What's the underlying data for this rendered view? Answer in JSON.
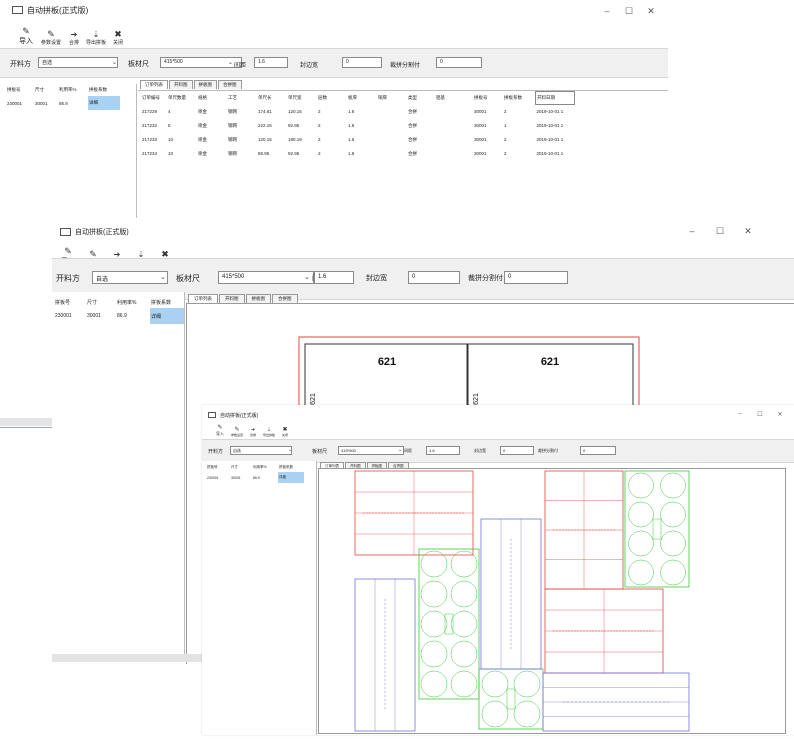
{
  "app": {
    "title": "自动拼板(正式版)",
    "win_controls": [
      "–",
      "☐",
      "✕"
    ]
  },
  "toolbar": [
    {
      "label": "导入",
      "icon": "import-icon"
    },
    {
      "label": "参数设置",
      "icon": "settings-icon"
    },
    {
      "label": "合排",
      "icon": "merge-icon"
    },
    {
      "label": "导出拼板",
      "icon": "export-icon"
    },
    {
      "label": "关闭",
      "icon": "close-icon"
    }
  ],
  "options": {
    "cut_label": "开料方",
    "cut_value": "自选",
    "board_label": "板材尺",
    "board_value": "415*500",
    "gap_label": "间距",
    "gap_value": "1.6",
    "edge_label": "封边宽",
    "edge_value": "0",
    "split_label": "裁拼分割付",
    "split_value": "0"
  },
  "left_table": {
    "headers": [
      "拼板号",
      "尺寸",
      "利用率%",
      "拼板系数"
    ],
    "rows": [
      [
        "230001",
        "30001",
        "86.9",
        "详细"
      ]
    ]
  },
  "tabs": [
    "订单列表",
    "开料图",
    "拼板图",
    "合拼图"
  ],
  "order_table": {
    "headers": [
      "订单编号",
      "单尺数量",
      "规格",
      "工艺",
      "单尺长",
      "单尺宽",
      "层数",
      "板厚",
      "铜厚",
      "类型",
      "铝基",
      "拼板号",
      "拼板系数",
      "开料日期"
    ],
    "rows": [
      [
        "217229",
        "4",
        "喷金",
        "钢网",
        "174.61",
        "120.15",
        "2",
        "1.6",
        "",
        "合拼",
        "",
        "30001",
        "2",
        "2019-10-01 1"
      ],
      [
        "217232",
        "5",
        "喷金",
        "钢网",
        "222.15",
        "92.95",
        "2",
        "1.6",
        "",
        "合拼",
        "",
        "30001",
        "1",
        "2019-10-01 1"
      ],
      [
        "217233",
        "10",
        "喷金",
        "钢网",
        "120.15",
        "180.19",
        "2",
        "1.6",
        "",
        "合拼",
        "",
        "30001",
        "2",
        "2019-10-01 1"
      ],
      [
        "217234",
        "10",
        "喷金",
        "钢网",
        "86.95",
        "92.95",
        "2",
        "1.6",
        "",
        "合拼",
        "",
        "30001",
        "2",
        "2019-10-01 1"
      ]
    ]
  },
  "cut_drawing": {
    "piece_labels": [
      "621",
      "621"
    ],
    "side_labels": [
      "621",
      "621"
    ]
  },
  "colors": {
    "red": "#e0473c",
    "green": "#3cc93c",
    "blue": "#7373d6",
    "selection": "#a9d2f2"
  }
}
